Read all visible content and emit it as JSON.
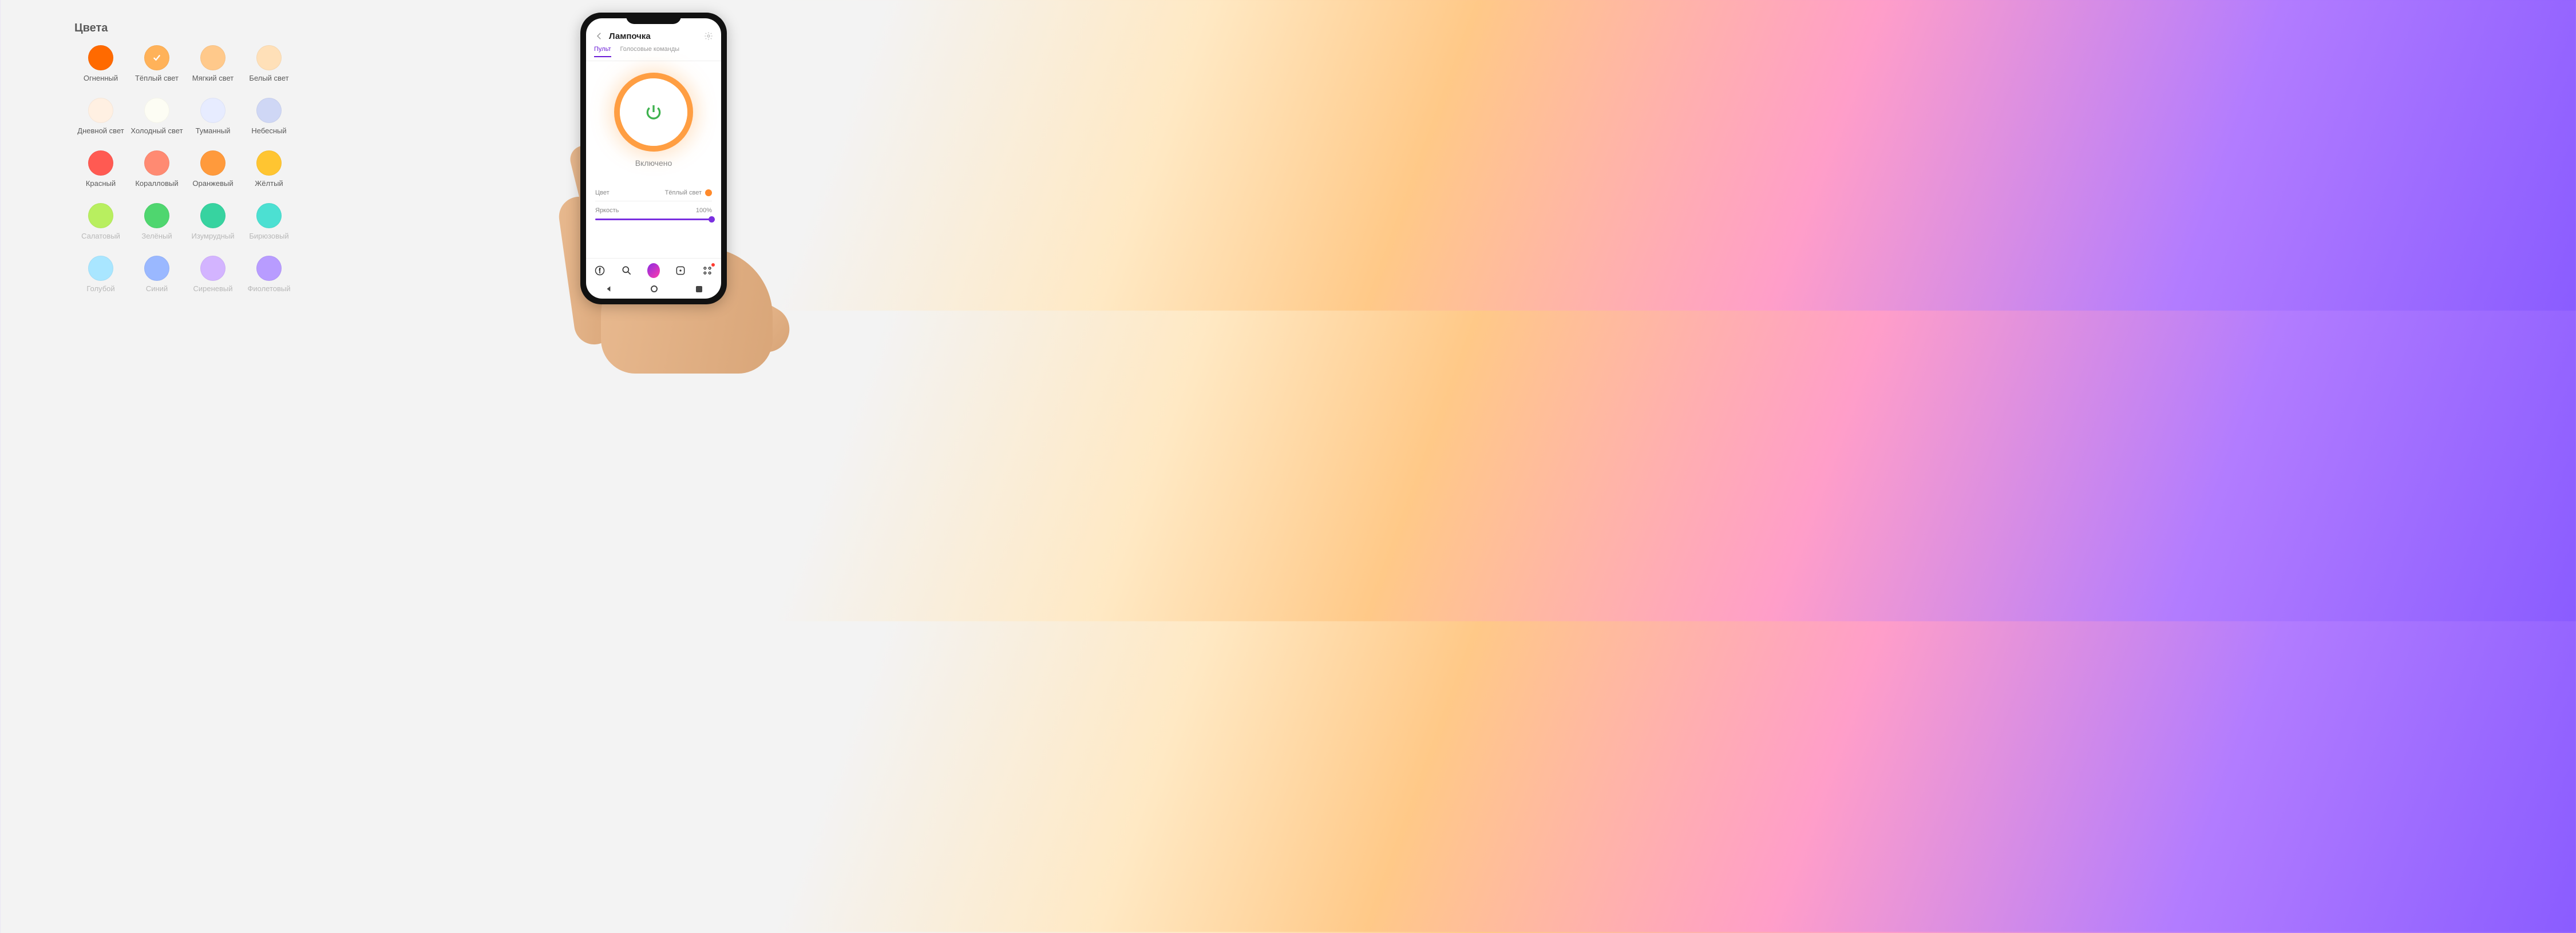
{
  "palette": {
    "title": "Цвета",
    "selected_index": 1,
    "colors": [
      {
        "name": "Огненный",
        "hex": "#ff6a00",
        "faded": false
      },
      {
        "name": "Тёплый свет",
        "hex": "#ffb259",
        "faded": false
      },
      {
        "name": "Мягкий свет",
        "hex": "#ffc98b",
        "faded": false
      },
      {
        "name": "Белый свет",
        "hex": "#ffe0b8",
        "faded": false
      },
      {
        "name": "Дневной свет",
        "hex": "#fff0e2",
        "faded": false
      },
      {
        "name": "Холодный свет",
        "hex": "#fdfdf4",
        "faded": false
      },
      {
        "name": "Туманный",
        "hex": "#e7ecff",
        "faded": false
      },
      {
        "name": "Небесный",
        "hex": "#cfd7f5",
        "faded": false
      },
      {
        "name": "Красный",
        "hex": "#ff5a52",
        "faded": false
      },
      {
        "name": "Коралловый",
        "hex": "#ff8a72",
        "faded": false
      },
      {
        "name": "Оранжевый",
        "hex": "#ff9a3c",
        "faded": false
      },
      {
        "name": "Жёлтый",
        "hex": "#ffc531",
        "faded": false
      },
      {
        "name": "Салатовый",
        "hex": "#b8ef5f",
        "faded": true
      },
      {
        "name": "Зелёный",
        "hex": "#4fd66f",
        "faded": true
      },
      {
        "name": "Изумрудный",
        "hex": "#37d3a0",
        "faded": true
      },
      {
        "name": "Бирюзовый",
        "hex": "#4ce0d2",
        "faded": true
      },
      {
        "name": "Голубой",
        "hex": "#a9e6ff",
        "faded": true
      },
      {
        "name": "Синий",
        "hex": "#9ab8ff",
        "faded": true
      },
      {
        "name": "Сиреневый",
        "hex": "#d3b4ff",
        "faded": true
      },
      {
        "name": "Фиолетовый",
        "hex": "#b89cff",
        "faded": true
      }
    ]
  },
  "phone": {
    "app": {
      "title": "Лампочка",
      "tabs": [
        {
          "label": "Пульт",
          "active": true
        },
        {
          "label": "Голосовые команды",
          "active": false
        }
      ],
      "power": {
        "status_label": "Включено",
        "on": true,
        "ring_color": "#ff8a2b"
      },
      "color_row": {
        "label": "Цвет",
        "value_label": "Тёплый свет",
        "value_hex": "#ff8a2b"
      },
      "brightness_row": {
        "label": "Яркость",
        "value_label": "100%",
        "value_percent": 100
      }
    },
    "nav_icons": [
      "yandex-icon",
      "search-icon",
      "alice-icon",
      "browser-icon",
      "services-icon"
    ]
  }
}
